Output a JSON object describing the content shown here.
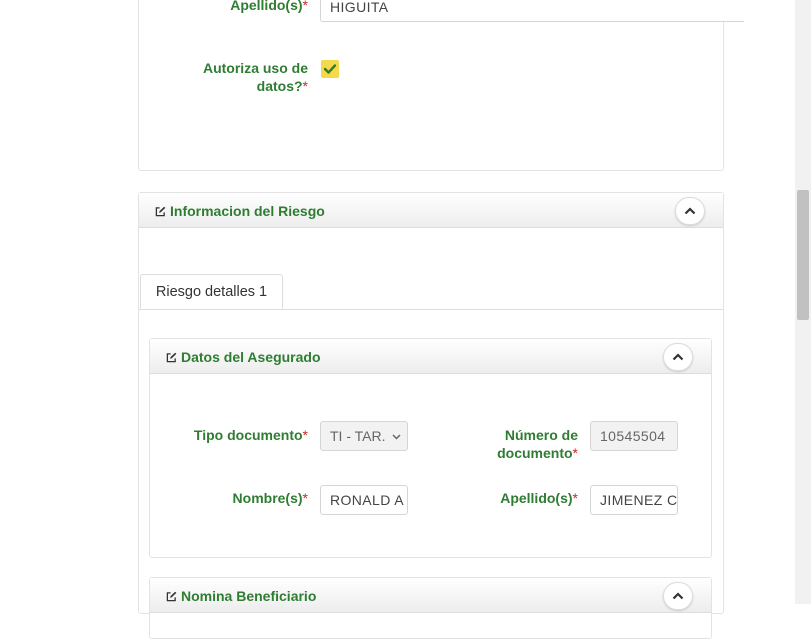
{
  "top_form": {
    "apellido_label": "Apellido(s)",
    "apellido_value": "HIGUITA",
    "autoriza_label_line1": "Autoriza uso de",
    "autoriza_label_line2": "datos?",
    "autoriza_checked": true,
    "required_mark": "*"
  },
  "riesgo_panel": {
    "title": "Informacion del Riesgo",
    "tab_label": "Riesgo detalles 1"
  },
  "asegurado_panel": {
    "title": "Datos del Asegurado",
    "tipo_documento_label": "Tipo documento",
    "tipo_documento_value": "TI - TAR.",
    "numero_documento_label_line1": "Número de",
    "numero_documento_label_line2": "documento",
    "numero_documento_value": "10545504",
    "nombre_label": "Nombre(s)",
    "nombre_value": "RONALD A",
    "apellido_label": "Apellido(s)",
    "apellido_value": "JIMENEZ C"
  },
  "beneficiario_panel": {
    "title": "Nomina Beneficiario"
  },
  "icons": {
    "edit": "edit-icon",
    "collapse": "chevron-up-icon",
    "check": "check-icon",
    "dropdown": "chevron-down-icon"
  },
  "colors": {
    "label_green": "#2e7d32",
    "required_red": "#c62828",
    "checkbox_yellow": "#f5d94a"
  }
}
